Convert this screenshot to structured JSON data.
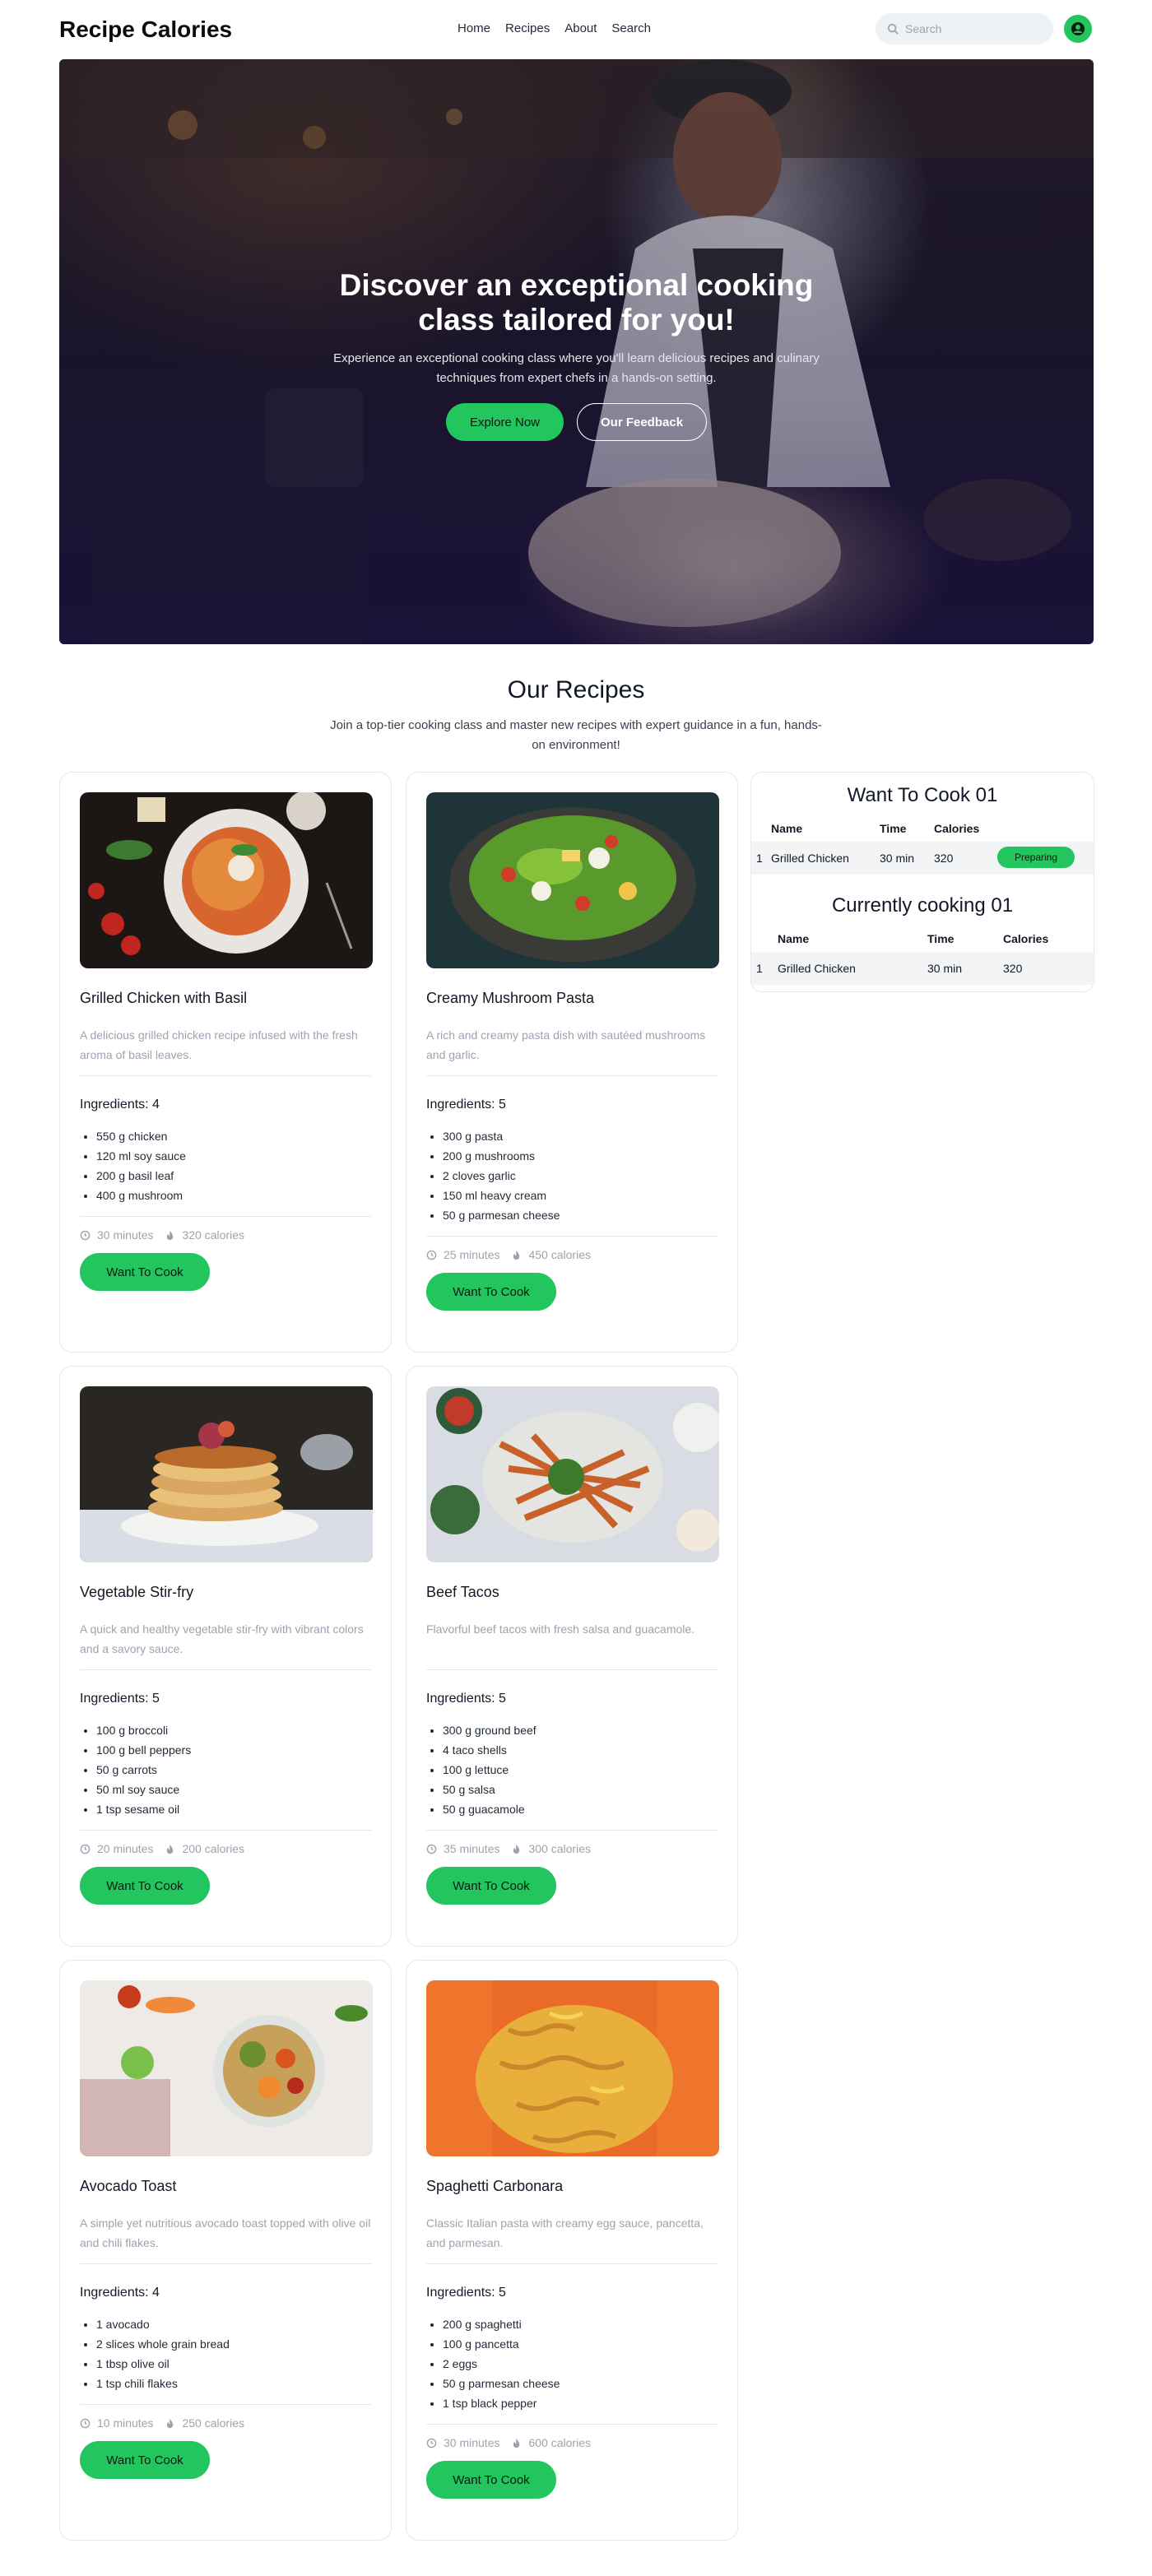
{
  "header": {
    "brand": "Recipe Calories",
    "nav": [
      "Home",
      "Recipes",
      "About",
      "Search"
    ],
    "search_placeholder": "Search"
  },
  "hero": {
    "title": "Discover an exceptional cooking class tailored for you!",
    "subtitle": "Experience an exceptional cooking class where you'll learn delicious recipes and culinary techniques from expert chefs in a hands-on setting.",
    "primary_button": "Explore Now",
    "secondary_button": "Our Feedback"
  },
  "recipes_section": {
    "title": "Our Recipes",
    "subtitle": "Join a top-tier cooking class and master new recipes with expert guidance in a fun, hands-on environment!"
  },
  "recipes": [
    {
      "name": "Grilled Chicken with Basil",
      "description": "A delicious grilled chicken recipe infused with the fresh aroma of basil leaves.",
      "ingredients_label": "Ingredients: 4",
      "ingredients": [
        "550 g chicken",
        "120 ml soy sauce",
        "200 g basil leaf",
        "400 g mushroom"
      ],
      "time": "30 minutes",
      "calories": "320 calories",
      "button": "Want To Cook",
      "image_icon": "pasta-plate-photo"
    },
    {
      "name": "Creamy Mushroom Pasta",
      "description": "A rich and creamy pasta dish with sautéed mushrooms and garlic.",
      "ingredients_label": "Ingredients: 5",
      "ingredients": [
        "300 g pasta",
        "200 g mushrooms",
        "2 cloves garlic",
        "150 ml heavy cream",
        "50 g parmesan cheese"
      ],
      "time": "25 minutes",
      "calories": "450 calories",
      "button": "Want To Cook",
      "image_icon": "salad-bowl-photo"
    },
    {
      "name": "Vegetable Stir-fry",
      "description": "A quick and healthy vegetable stir-fry with vibrant colors and a savory sauce.",
      "ingredients_label": "Ingredients: 5",
      "ingredients": [
        "100 g broccoli",
        "100 g bell peppers",
        "50 g carrots",
        "50 ml soy sauce",
        "1 tsp sesame oil"
      ],
      "time": "20 minutes",
      "calories": "200 calories",
      "button": "Want To Cook",
      "image_icon": "pancake-stack-photo"
    },
    {
      "name": "Beef Tacos",
      "description": "Flavorful beef tacos with fresh salsa and guacamole.",
      "ingredients_label": "Ingredients: 5",
      "ingredients": [
        "300 g ground beef",
        "4 taco shells",
        "100 g lettuce",
        "50 g salsa",
        "50 g guacamole"
      ],
      "time": "35 minutes",
      "calories": "300 calories",
      "button": "Want To Cook",
      "image_icon": "fries-platter-photo"
    },
    {
      "name": "Avocado Toast",
      "description": "A simple yet nutritious avocado toast topped with olive oil and chili flakes.",
      "ingredients_label": "Ingredients: 4",
      "ingredients": [
        "1 avocado",
        "2 slices whole grain bread",
        "1 tbsp olive oil",
        "1 tsp chili flakes"
      ],
      "time": "10 minutes",
      "calories": "250 calories",
      "button": "Want To Cook",
      "image_icon": "veggie-bowl-photo"
    },
    {
      "name": "Spaghetti Carbonara",
      "description": "Classic Italian pasta with creamy egg sauce, pancetta, and parmesan.",
      "ingredients_label": "Ingredients: 5",
      "ingredients": [
        "200 g spaghetti",
        "100 g pancetta",
        "2 eggs",
        "50 g parmesan cheese",
        "1 tsp black pepper"
      ],
      "time": "30 minutes",
      "calories": "600 calories",
      "button": "Want To Cook",
      "image_icon": "fusilli-pasta-photo"
    }
  ],
  "want_to_cook": {
    "title": "Want To Cook 01",
    "columns": [
      "Name",
      "Time",
      "Calories"
    ],
    "rows": [
      {
        "index": "1",
        "name": "Grilled Chicken",
        "time": "30 min",
        "calories": "320",
        "action": "Preparing"
      }
    ]
  },
  "currently_cooking": {
    "title": "Currently cooking 01",
    "columns": [
      "Name",
      "Time",
      "Calories"
    ],
    "rows": [
      {
        "index": "1",
        "name": "Grilled Chicken",
        "time": "30 min",
        "calories": "320"
      }
    ]
  },
  "colors": {
    "accent": "#22c55e",
    "muted_text": "#9ca3af",
    "border": "#e5e7eb"
  }
}
